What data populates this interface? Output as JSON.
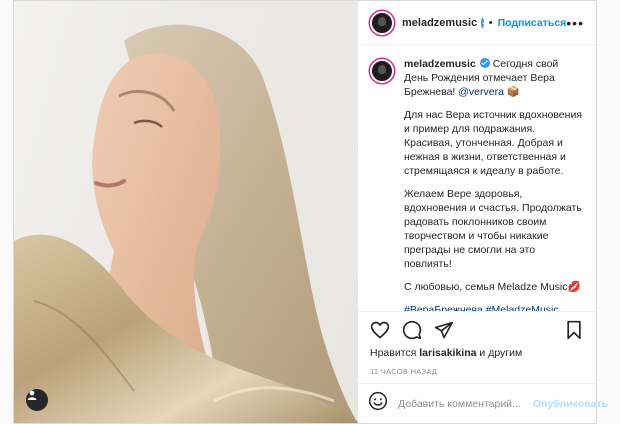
{
  "post": {
    "username": "meladzemusic",
    "follow_label": "Подписаться",
    "more_icon": "more-options-icon",
    "caption": {
      "line1": "Сегодня свой День Рождения отмечает Вера Брежнева!",
      "mention": "@ververa",
      "emoji1": "📦",
      "p2": "Для нас Вера источник вдохновения и пример для подражания. Красивая, утонченная. Добрая и нежная в жизни, ответственная и стремящаяся к идеалу в работе.",
      "p3": "Желаем Вере здоровья, вдохновения и счастья. Продолжать радовать поклонников своим творчеством и чтобы никакие преграды не смогли на это повлиять!",
      "p4": "С любовью, семья Meladze Music",
      "emoji2": "💋",
      "hashtags": "#ВераБрежнева #MeladzeMusic"
    },
    "likes": {
      "prefix": "Нравится",
      "user": "larisakikina",
      "suffix": "и другим"
    },
    "timestamp": "11 ЧАСОВ НАЗАД",
    "comment": {
      "placeholder": "Добавить комментарий...",
      "publish_label": "Опубликовать"
    }
  },
  "colors": {
    "accent": "#0095f6",
    "verified": "#3897f0",
    "publish_disabled": "#b2dffc"
  }
}
